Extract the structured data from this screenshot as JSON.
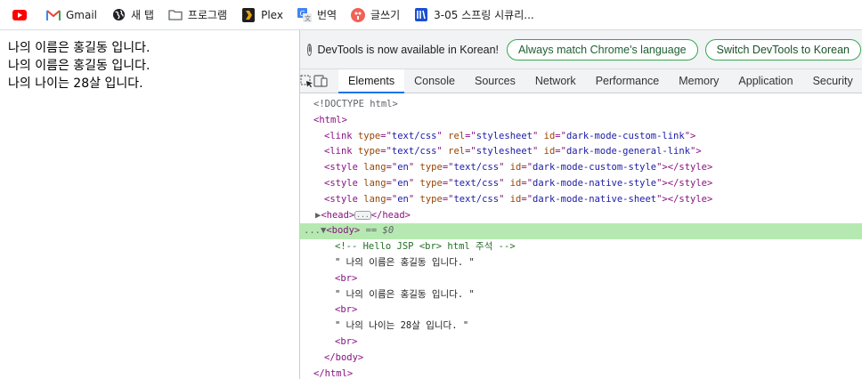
{
  "bookmarks": [
    {
      "label": "",
      "icon": "youtube-icon"
    },
    {
      "label": "Gmail",
      "icon": "gmail-icon"
    },
    {
      "label": "새 탭",
      "icon": "globe-icon"
    },
    {
      "label": "프로그램",
      "icon": "folder-icon"
    },
    {
      "label": "Plex",
      "icon": "plex-icon"
    },
    {
      "label": "번역",
      "icon": "translate-icon"
    },
    {
      "label": "글쓰기",
      "icon": "write-icon"
    },
    {
      "label": "3-05 스프링 시큐리...",
      "icon": "book-icon"
    }
  ],
  "page": {
    "lines": [
      "나의 이름은 홍길동 입니다.",
      "나의 이름은 홍길동 입니다.",
      "나의 나이는 28살 입니다."
    ]
  },
  "devtools": {
    "infobar": {
      "message": "DevTools is now available in Korean!",
      "btn_match": "Always match Chrome's language",
      "btn_switch": "Switch DevTools to Korean"
    },
    "tabs": [
      "Elements",
      "Console",
      "Sources",
      "Network",
      "Performance",
      "Memory",
      "Application",
      "Security"
    ],
    "active_tab": "Elements",
    "dom": {
      "doctype": "<!DOCTYPE html>",
      "html_open": "<html>",
      "link1": {
        "tag": "link",
        "type": "text/css",
        "rel": "stylesheet",
        "id": "dark-mode-custom-link"
      },
      "link2": {
        "tag": "link",
        "type": "text/css",
        "rel": "stylesheet",
        "id": "dark-mode-general-link"
      },
      "style1": {
        "tag": "style",
        "lang": "en",
        "type": "text/css",
        "id": "dark-mode-custom-style"
      },
      "style2": {
        "tag": "style",
        "lang": "en",
        "type": "text/css",
        "id": "dark-mode-native-style"
      },
      "style3": {
        "tag": "style",
        "lang": "en",
        "type": "text/css",
        "id": "dark-mode-native-sheet"
      },
      "head_open": "<head>",
      "head_close": "</head>",
      "body_open": "<body>",
      "body_eq": "== $0",
      "comment": "<!-- Hello JSP <br> html 주석 -->",
      "text1": "\" 나의 이름은 홍길동 입니다. \"",
      "br": "<br>",
      "text2": "\" 나의 이름은 홍길동 입니다. \"",
      "text3": "\" 나의 나이는 28살 입니다. \"",
      "body_close": "</body>",
      "html_close": "</html>",
      "row_dots": "..."
    }
  }
}
